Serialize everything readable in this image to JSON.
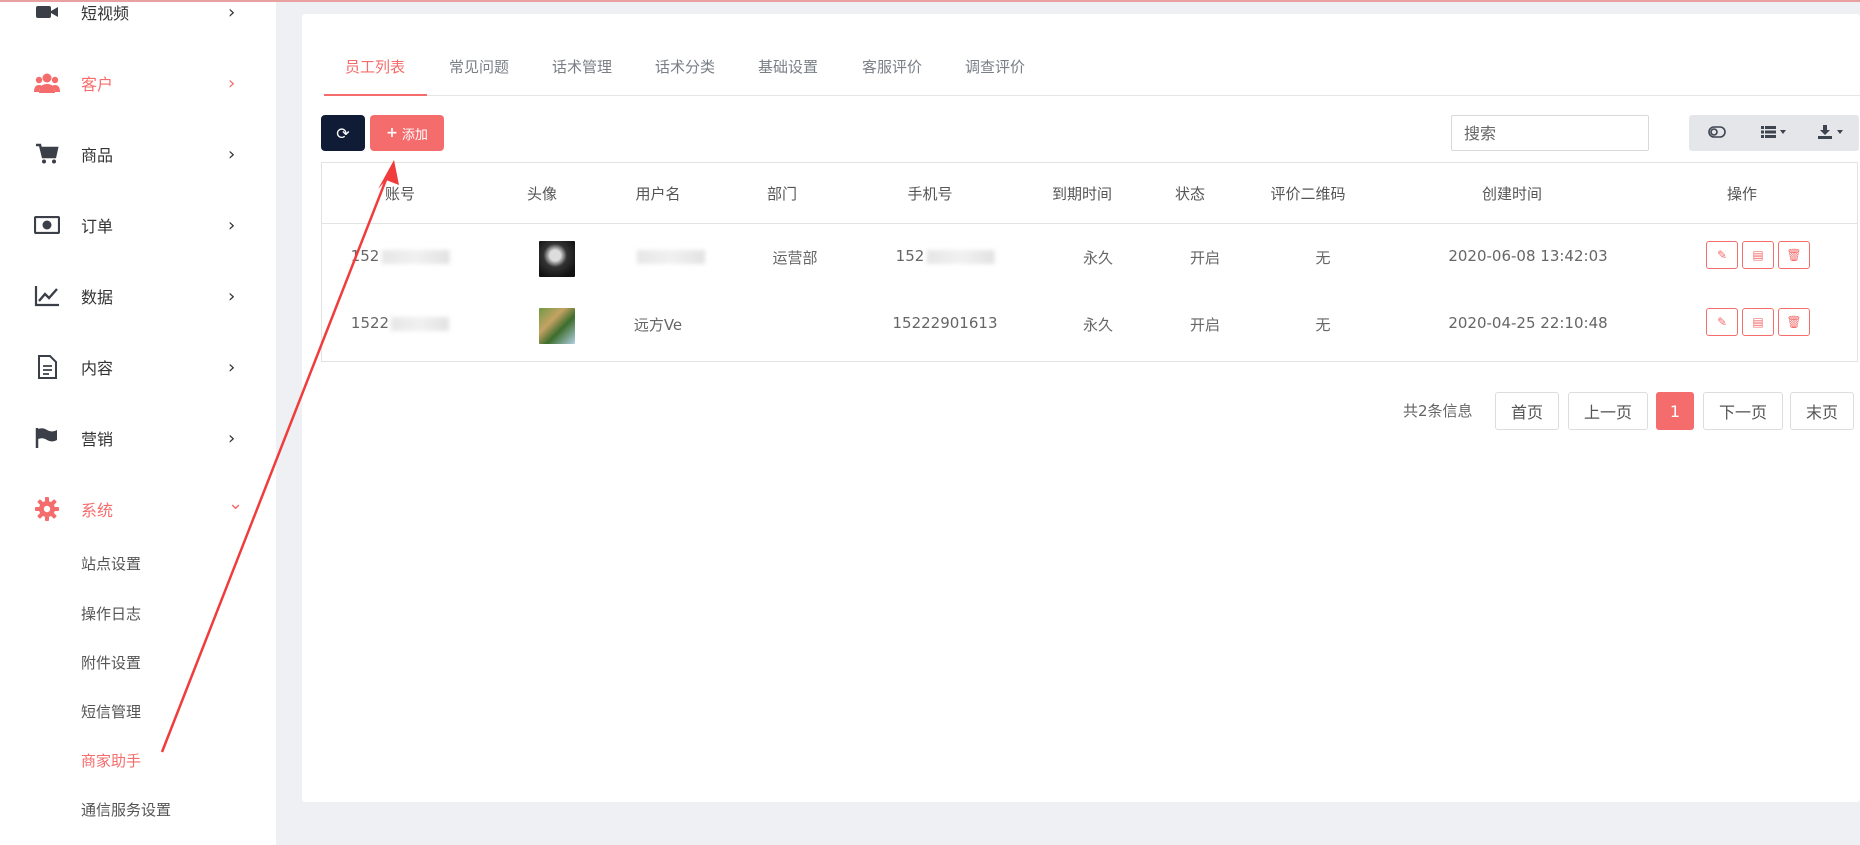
{
  "sidebar": {
    "items": [
      {
        "name": "video",
        "label": "短视频",
        "icon": "video-icon"
      },
      {
        "name": "customer",
        "label": "客户",
        "icon": "users-icon"
      },
      {
        "name": "goods",
        "label": "商品",
        "icon": "cart-icon"
      },
      {
        "name": "order",
        "label": "订单",
        "icon": "money-icon"
      },
      {
        "name": "data",
        "label": "数据",
        "icon": "chart-icon"
      },
      {
        "name": "content",
        "label": "内容",
        "icon": "document-icon"
      },
      {
        "name": "marketing",
        "label": "营销",
        "icon": "flag-icon"
      },
      {
        "name": "system",
        "label": "系统",
        "icon": "gear-icon"
      }
    ],
    "chev_right": "›",
    "chev_down": "⌄",
    "subitems": [
      {
        "label": "站点设置"
      },
      {
        "label": "操作日志"
      },
      {
        "label": "附件设置"
      },
      {
        "label": "短信管理"
      },
      {
        "label": "商家助手"
      },
      {
        "label": "通信服务设置"
      }
    ]
  },
  "tabs": [
    {
      "label": "员工列表"
    },
    {
      "label": "常见问题"
    },
    {
      "label": "话术管理"
    },
    {
      "label": "话术分类"
    },
    {
      "label": "基础设置"
    },
    {
      "label": "客服评价"
    },
    {
      "label": "调查评价"
    }
  ],
  "toolbar": {
    "refresh_icon": "⟳",
    "add_plus": "+",
    "add_label": "添加",
    "search_placeholder": "搜索"
  },
  "table": {
    "headers": [
      "账号",
      "头像",
      "用户名",
      "部门",
      "手机号",
      "到期时间",
      "状态",
      "评价二维码",
      "创建时间",
      "操作"
    ],
    "rows": [
      {
        "account": "152",
        "username": "",
        "department": "运营部",
        "phone": "152",
        "expire": "永久",
        "status": "开启",
        "qrcode": "无",
        "created": "2020-06-08 13:42:03"
      },
      {
        "account": "1522",
        "username": "远方Ve",
        "department": "",
        "phone": "15222901613",
        "expire": "永久",
        "status": "开启",
        "qrcode": "无",
        "created": "2020-04-25 22:10:48"
      }
    ]
  },
  "pagination": {
    "total": "共2条信息",
    "first": "首页",
    "prev": "上一页",
    "current": "1",
    "next": "下一页",
    "last": "末页"
  },
  "colors": {
    "accent": "#f56c6c",
    "dark_button": "#101c36",
    "annotation_arrow": "#f03c3c"
  }
}
